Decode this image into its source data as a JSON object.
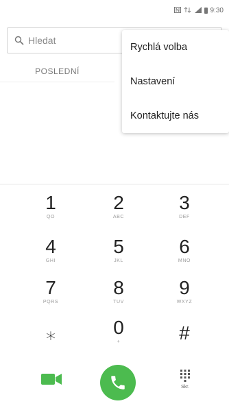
{
  "status_bar": {
    "time": "9:30",
    "icons": [
      "nfc-icon",
      "signal-icon",
      "battery-icon"
    ]
  },
  "search": {
    "placeholder": "Hledat"
  },
  "tabs": [
    {
      "label": "POSLEDNÍ"
    }
  ],
  "overflow_menu": {
    "items": [
      {
        "label": "Rychlá volba"
      },
      {
        "label": "Nastavení"
      },
      {
        "label": "Kontaktujte nás"
      }
    ]
  },
  "keypad": {
    "keys": [
      {
        "digit": "1",
        "letters": "QO"
      },
      {
        "digit": "2",
        "letters": "ABC"
      },
      {
        "digit": "3",
        "letters": "DEF"
      },
      {
        "digit": "4",
        "letters": "GHI"
      },
      {
        "digit": "5",
        "letters": "JKL"
      },
      {
        "digit": "6",
        "letters": "MNO"
      },
      {
        "digit": "7",
        "letters": "PQRS"
      },
      {
        "digit": "8",
        "letters": "TUV"
      },
      {
        "digit": "9",
        "letters": "WXYZ"
      },
      {
        "digit": "⁎",
        "letters": ""
      },
      {
        "digit": "0",
        "letters": "+"
      },
      {
        "digit": "#",
        "letters": ""
      }
    ]
  },
  "actions": {
    "dialpad_label": "Skr.",
    "call_color": "#4cbb4f",
    "video_color": "#4cbb4f"
  }
}
